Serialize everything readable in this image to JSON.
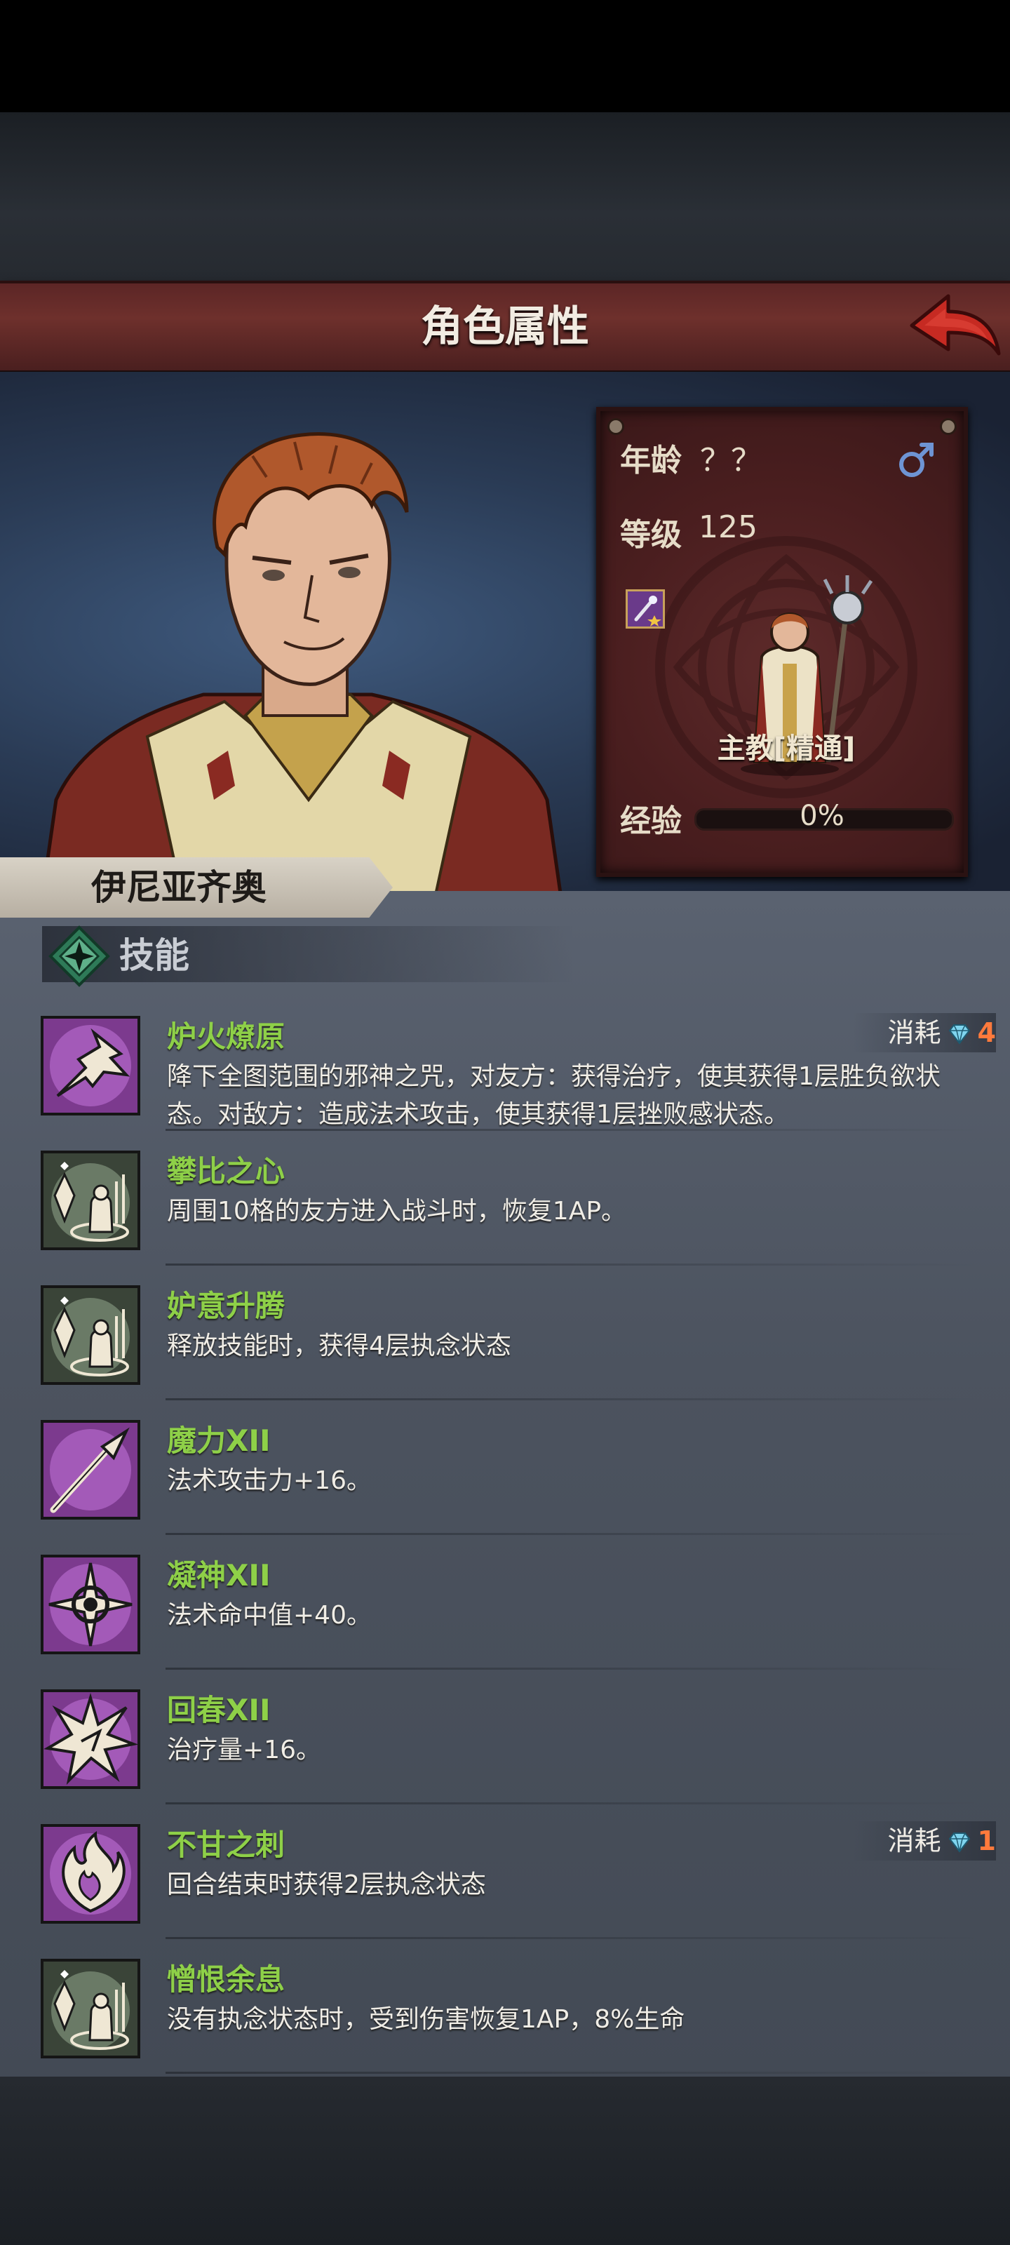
{
  "header": {
    "title": "角色属性"
  },
  "character": {
    "name": "伊尼亚齐奥",
    "age_label": "年龄",
    "age_value": "？？",
    "level_label": "等级",
    "level_value": "125",
    "class_name": "主教[精通]",
    "exp_label": "经验",
    "exp_value": "0%",
    "exp_fraction": 0
  },
  "skills": {
    "title": "技能",
    "items": [
      {
        "name": "炉火燎原",
        "desc": "降下全图范围的邪神之咒，对友方：获得治疗，使其获得1层胜负欲状态。对敌方：造成法术攻击，使其获得1层挫败感状态。",
        "cost_label": "消耗",
        "cost_value": "4",
        "icon": "flaming-fist-icon"
      },
      {
        "name": "攀比之心",
        "desc": "周围10格的友方进入战斗时，恢复1AP。",
        "icon": "crystal-statue-icon"
      },
      {
        "name": "妒意升腾",
        "desc": "释放技能时，获得4层执念状态",
        "icon": "crystal-statue-icon"
      },
      {
        "name": "魔力XII",
        "desc": "法术攻击力+16。",
        "icon": "spear-icon"
      },
      {
        "name": "凝神XII",
        "desc": "法术命中值+40。",
        "icon": "crosshair-icon"
      },
      {
        "name": "回春XII",
        "desc": "治疗量+16。",
        "icon": "starburst-icon"
      },
      {
        "name": "不甘之刺",
        "desc": "回合结束时获得2层执念状态",
        "cost_label": "消耗",
        "cost_value": "1",
        "icon": "fire-heart-icon"
      },
      {
        "name": "憎恨余息",
        "desc": "没有执念状态时，受到伤害恢复1AP，8%生命",
        "icon": "crystal-statue-icon"
      }
    ]
  },
  "colors": {
    "skill_name": "#8ed048",
    "cost_number": "#ff7a3c",
    "title_bar": "#6e302c"
  }
}
